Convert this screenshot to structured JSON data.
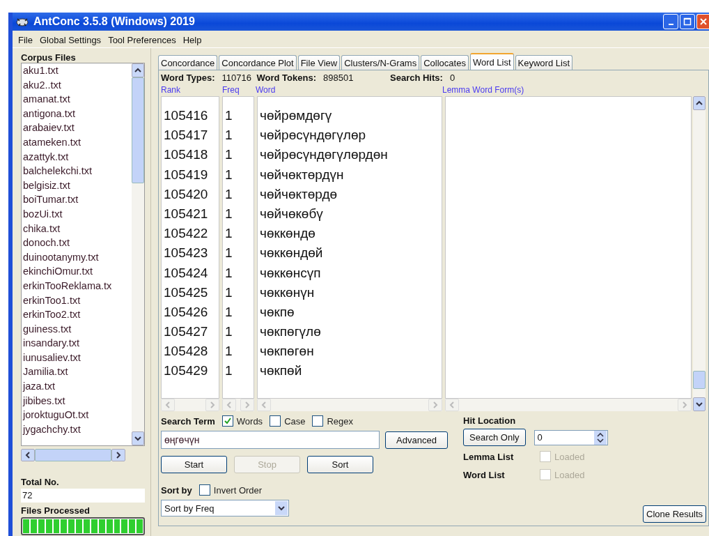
{
  "window": {
    "title": "AntConc 3.5.8 (Windows) 2019"
  },
  "menu": [
    "File",
    "Global Settings",
    "Tool Preferences",
    "Help"
  ],
  "corpus": {
    "label": "Corpus Files",
    "files": [
      "aku1.txt",
      "aku2..txt",
      "amanat.txt",
      "antigona.txt",
      "arabaiev.txt",
      "atameken.txt",
      "azattyk.txt",
      "balchelekchi.txt",
      "belgisiz.txt",
      "boiTumar.txt",
      "bozUi.txt",
      "chika.txt",
      "donoch.txt",
      "duinootanymy.txt",
      "ekinchiOmur.txt",
      "erkinTooReklama.tx",
      "erkinToo1.txt",
      "erkinToo2.txt",
      "guiness.txt",
      "insandary.txt",
      "iunusaliev.txt",
      "Jamilia.txt",
      "jaza.txt",
      "jibibes.txt",
      "joroktuguOt.txt",
      "jygachchy.txt"
    ],
    "total_label": "Total No.",
    "total": "72",
    "processed_label": "Files Processed",
    "progress": {
      "level": 1
    }
  },
  "tabs": [
    {
      "label": "Concordance",
      "selected": false
    },
    {
      "label": "Concordance Plot",
      "selected": false
    },
    {
      "label": "File View",
      "selected": false
    },
    {
      "label": "Clusters/N-Grams",
      "selected": false
    },
    {
      "label": "Collocates",
      "selected": false
    },
    {
      "label": "Word List",
      "selected": true
    },
    {
      "label": "Keyword List",
      "selected": false
    }
  ],
  "stats": [
    {
      "label": "Word Types:",
      "value": "110716"
    },
    {
      "label": "Word Tokens:",
      "value": "898501"
    },
    {
      "label": "Search Hits:",
      "value": "0"
    }
  ],
  "columns": [
    "Rank",
    "Freq",
    "Word",
    "Lemma Word Form(s)"
  ],
  "rows": [
    {
      "rank": "105416",
      "freq": "1",
      "word": "чөйрөмдөгү"
    },
    {
      "rank": "105417",
      "freq": "1",
      "word": "чөйрөсүндөгүлөр"
    },
    {
      "rank": "105418",
      "freq": "1",
      "word": "чөйрөсүндөгүлөрдөн"
    },
    {
      "rank": "105419",
      "freq": "1",
      "word": "чөйчөктөрдүн"
    },
    {
      "rank": "105420",
      "freq": "1",
      "word": "чөйчөктөрдө"
    },
    {
      "rank": "105421",
      "freq": "1",
      "word": "чөйчөкөбү"
    },
    {
      "rank": "105422",
      "freq": "1",
      "word": "чөккөндө"
    },
    {
      "rank": "105423",
      "freq": "1",
      "word": "чөккөндөй"
    },
    {
      "rank": "105424",
      "freq": "1",
      "word": "чөккөнсүп"
    },
    {
      "rank": "105425",
      "freq": "1",
      "word": "чөккөнүн"
    },
    {
      "rank": "105426",
      "freq": "1",
      "word": "чөкпө"
    },
    {
      "rank": "105427",
      "freq": "1",
      "word": "чөкпөгүлө"
    },
    {
      "rank": "105428",
      "freq": "1",
      "word": "чөкпөгөн"
    },
    {
      "rank": "105429",
      "freq": "1",
      "word": "чөкпөй"
    }
  ],
  "search": {
    "label": "Search Term",
    "options": [
      {
        "label": "Words",
        "checked": true
      },
      {
        "label": "Case",
        "checked": false
      },
      {
        "label": "Regex",
        "checked": false
      }
    ],
    "value": "өңгөчүн",
    "advanced": "Advanced"
  },
  "actions": [
    {
      "label": "Start",
      "disabled": false
    },
    {
      "label": "Stop",
      "disabled": true
    },
    {
      "label": "Sort",
      "disabled": false
    }
  ],
  "sort": {
    "label": "Sort by",
    "invert": {
      "label": "Invert Order",
      "checked": false
    },
    "value": "Sort by Freq"
  },
  "hit_location": {
    "label": "Hit Location",
    "button": "Search Only",
    "value": "0"
  },
  "lists": [
    {
      "label": "Lemma List",
      "loaded_label": "Loaded",
      "checked": false,
      "disabled": true
    },
    {
      "label": "Word List",
      "loaded_label": "Loaded",
      "checked": false,
      "disabled": true
    }
  ],
  "clone": "Clone Results"
}
